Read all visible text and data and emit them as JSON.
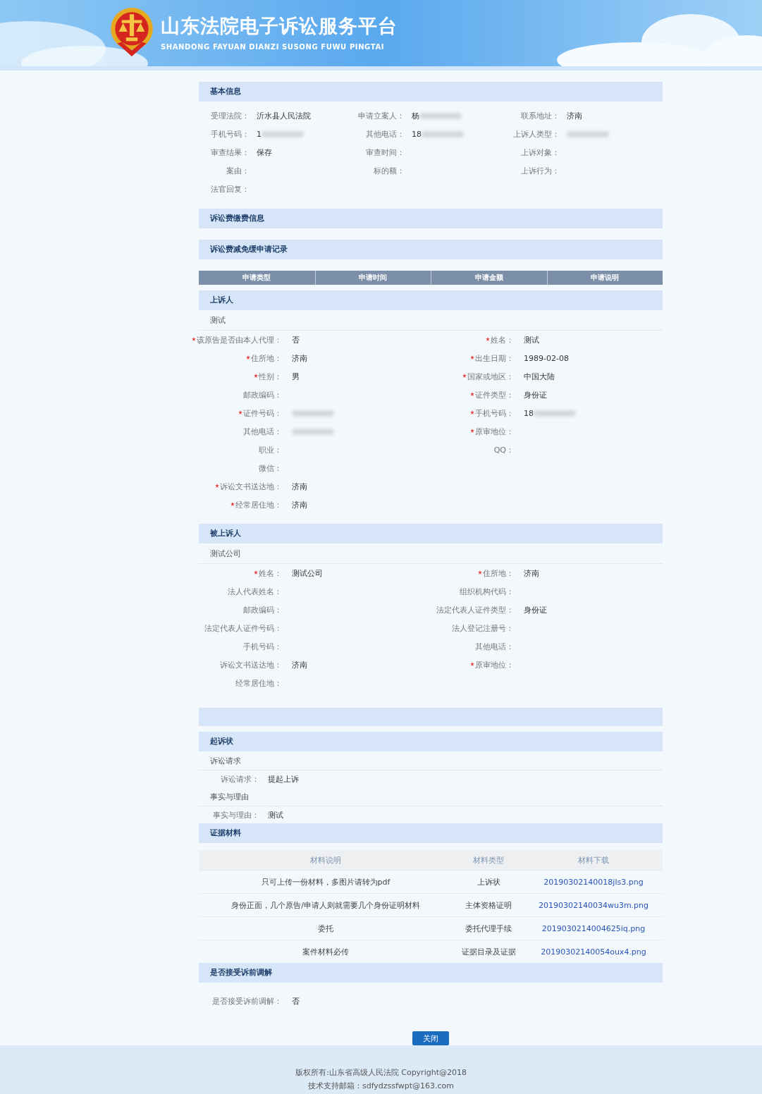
{
  "header": {
    "title": "山东法院电子诉讼服务平台",
    "subtitle": "SHANDONG FAYUAN DIANZI SUSONG FUWU PINGTAI"
  },
  "basic_info": {
    "title": "基本信息",
    "fields": [
      {
        "label": "受理法院：",
        "value": "沂水县人民法院",
        "blurred": false
      },
      {
        "label": "申请立案人：",
        "value": "杨",
        "blurred": true
      },
      {
        "label": "联系地址：",
        "value": "济南",
        "blurred": false
      },
      {
        "label": "手机号码：",
        "value": "1",
        "blurred": true
      },
      {
        "label": "其他电话：",
        "value": "18",
        "blurred": true
      },
      {
        "label": "上诉人类型：",
        "blurred": true
      },
      {
        "label": "审查结果：",
        "value": "保存",
        "blurred": false
      },
      {
        "label": "审查时间：",
        "blurred": false
      },
      {
        "label": "上诉对象：",
        "blurred": false
      },
      {
        "label": "案由：",
        "blurred": false
      },
      {
        "label": "标的额：",
        "blurred": false
      },
      {
        "label": "上诉行为：",
        "blurred": false
      },
      {
        "label": "法官回复：",
        "blurred": false
      }
    ]
  },
  "fee_payment": {
    "title": "诉讼费缴费信息"
  },
  "fee_reduction": {
    "title": "诉讼费减免缓申请记录",
    "columns": [
      "申请类型",
      "申请时间",
      "申请金额",
      "申请说明"
    ]
  },
  "appellant": {
    "title": "上诉人",
    "name": "测试",
    "rows": [
      [
        {
          "label": "该原告是否由本人代理：",
          "value": "否",
          "required": true,
          "blurred": false
        },
        {
          "label": "姓名：",
          "value": "测试",
          "required": true,
          "blurred": false
        }
      ],
      [
        {
          "label": "住所地：",
          "value": "济南",
          "required": true,
          "blurred": false
        },
        {
          "label": "出生日期：",
          "value": "1989-02-08",
          "required": true,
          "blurred": false
        }
      ],
      [
        {
          "label": "性别：",
          "value": "男",
          "required": true,
          "blurred": false
        },
        {
          "label": "国家或地区：",
          "value": "中国大陆",
          "required": true,
          "blurred": false
        }
      ],
      [
        {
          "label": "邮政编码：",
          "required": false,
          "blurred": false
        },
        {
          "label": "证件类型：",
          "value": "身份证",
          "required": true,
          "blurred": false
        }
      ],
      [
        {
          "label": "证件号码：",
          "required": true,
          "blurred": true
        },
        {
          "label": "手机号码：",
          "value": "18",
          "required": true,
          "blurred": true
        }
      ],
      [
        {
          "label": "其他电话：",
          "required": false,
          "blurred": true
        },
        {
          "label": "原审地位：",
          "required": true,
          "blurred": false
        }
      ],
      [
        {
          "label": "职业：",
          "required": false,
          "blurred": false
        },
        {
          "label": "QQ：",
          "required": false,
          "blurred": false
        }
      ],
      [
        {
          "label": "微信：",
          "required": false,
          "blurred": false
        }
      ],
      [
        {
          "label": "诉讼文书送达地：",
          "value": "济南",
          "required": true,
          "blurred": false
        }
      ],
      [
        {
          "label": "经常居住地：",
          "value": "济南",
          "required": true,
          "blurred": false
        }
      ]
    ]
  },
  "respondent": {
    "title": "被上诉人",
    "name": "测试公司",
    "rows": [
      [
        {
          "label": "姓名：",
          "value": "测试公司",
          "required": true,
          "blurred": false
        },
        {
          "label": "住所地：",
          "value": "济南",
          "required": true,
          "blurred": false
        }
      ],
      [
        {
          "label": "法人代表姓名：",
          "required": false,
          "blurred": false
        },
        {
          "label": "组织机构代码：",
          "required": false,
          "blurred": false
        }
      ],
      [
        {
          "label": "邮政编码：",
          "required": false,
          "blurred": false
        },
        {
          "label": "法定代表人证件类型：",
          "value": "身份证",
          "required": false,
          "blurred": false
        }
      ],
      [
        {
          "label": "法定代表人证件号码：",
          "required": false,
          "blurred": false
        },
        {
          "label": "法人登记注册号：",
          "required": false,
          "blurred": false
        }
      ],
      [
        {
          "label": "手机号码：",
          "required": false,
          "blurred": false
        },
        {
          "label": "其他电话：",
          "required": false,
          "blurred": false
        }
      ],
      [
        {
          "label": "诉讼文书送达地：",
          "value": "济南",
          "required": false,
          "blurred": false
        },
        {
          "label": "原审地位：",
          "required": true,
          "blurred": false
        }
      ],
      [
        {
          "label": "经常居住地：",
          "required": false,
          "blurred": false
        }
      ]
    ]
  },
  "complaint": {
    "title": "起诉状",
    "groups": [
      {
        "heading": "诉讼请求",
        "label": "诉讼请求：",
        "value": "提起上诉"
      },
      {
        "heading": "事实与理由",
        "label": "事实与理由：",
        "value": "测试"
      }
    ]
  },
  "evidence": {
    "title": "证据材料",
    "columns": [
      "材料说明",
      "材料类型",
      "材料下载"
    ],
    "rows": [
      {
        "description": "只可上传一份材料，多图片请转为pdf",
        "type": "上诉状",
        "file": "20190302140018jls3.png"
      },
      {
        "description": "身份正面，几个原告/申请人则就需要几个身份证明材料",
        "type": "主体资格证明",
        "file": "20190302140034wu3m.png"
      },
      {
        "description": "委托",
        "type": "委托代理手续",
        "file": "2019030214004625iq.png"
      },
      {
        "description": "案件材料必传",
        "type": "证据目录及证据",
        "file": "20190302140054oux4.png"
      }
    ]
  },
  "mediation": {
    "title": "是否接受诉前调解",
    "label": "是否接受诉前调解：",
    "value": "否"
  },
  "close_button": "关闭",
  "footer": [
    "版权所有:山东省高级人民法院 Copyright@2018",
    "技术支持邮箱：sdfydzssfwpt@163.com"
  ]
}
